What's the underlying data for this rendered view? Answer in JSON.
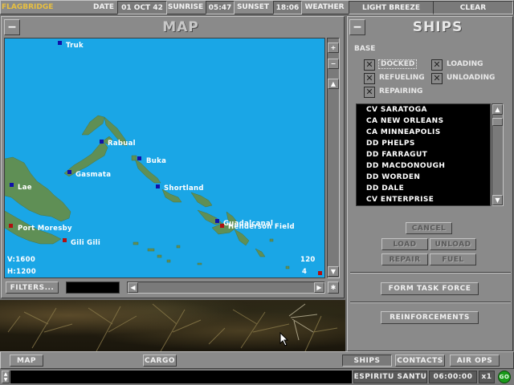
{
  "top_bar": {
    "app_title": "FLAGBRIDGE",
    "date_label": "DATE",
    "date_value": "01 OCT 42",
    "sunrise_label": "SUNRISE",
    "sunrise_value": "05:47",
    "sunset_label": "SUNSET",
    "sunset_value": "18:06",
    "weather_label": "WEATHER",
    "wind_value": "LIGHT BREEZE",
    "sky_value": "CLEAR"
  },
  "map_panel": {
    "title": "MAP",
    "collapse_label": "−",
    "places": [
      {
        "name": "Truk",
        "kind": "blue"
      },
      {
        "name": "Rabual",
        "kind": "blue"
      },
      {
        "name": "Buka",
        "kind": "blue"
      },
      {
        "name": "Gasmata",
        "kind": "blue"
      },
      {
        "name": "Shortland",
        "kind": "blue"
      },
      {
        "name": "Lae",
        "kind": "blue"
      },
      {
        "name": "Guadalcanal",
        "kind": "blue"
      },
      {
        "name": "Henderson Field",
        "kind": "red"
      },
      {
        "name": "Port Moresby",
        "kind": "red"
      },
      {
        "name": "Gili Gili",
        "kind": "red"
      }
    ],
    "v_readout": "V:1600",
    "h_readout": "H:1200",
    "right_readout_top": "120",
    "right_readout_bottom": "4",
    "filters_label": "FILTERS...",
    "colors": {
      "ocean": "#1aa6e6",
      "land": "#5f8f55",
      "base_blue": "#1010a8",
      "base_red": "#b01010"
    }
  },
  "ships_panel": {
    "title": "SHIPS",
    "collapse_label": "−",
    "base_label": "BASE",
    "checkboxes": [
      {
        "label": "DOCKED",
        "checked": true
      },
      {
        "label": "LOADING",
        "checked": true
      },
      {
        "label": "REFUELING",
        "checked": true
      },
      {
        "label": "UNLOADING",
        "checked": true
      },
      {
        "label": "REPAIRING",
        "checked": true
      }
    ],
    "ships": [
      "CV SARATOGA",
      "CA NEW ORLEANS",
      "CA MINNEAPOLIS",
      "DD PHELPS",
      "DD FARRAGUT",
      "DD MACDONOUGH",
      "DD WORDEN",
      "DD DALE",
      "CV ENTERPRISE"
    ],
    "cancel_label": "CANCEL",
    "load_label": "LOAD",
    "unload_label": "UNLOAD",
    "repair_label": "REPAIR",
    "fuel_label": "FUEL",
    "form_task_force_label": "FORM TASK FORCE",
    "reinforcements_label": "REINFORCEMENTS"
  },
  "bottom_bar": {
    "map_label": "MAP",
    "cargo_label": "CARGO",
    "ships_label": "SHIPS",
    "contacts_label": "CONTACTS",
    "air_ops_label": "AIR OPS"
  },
  "status_bar": {
    "location": "ESPIRITU SANTU",
    "clock": "06:00:00",
    "speed": "x1",
    "go_label": "GO"
  }
}
